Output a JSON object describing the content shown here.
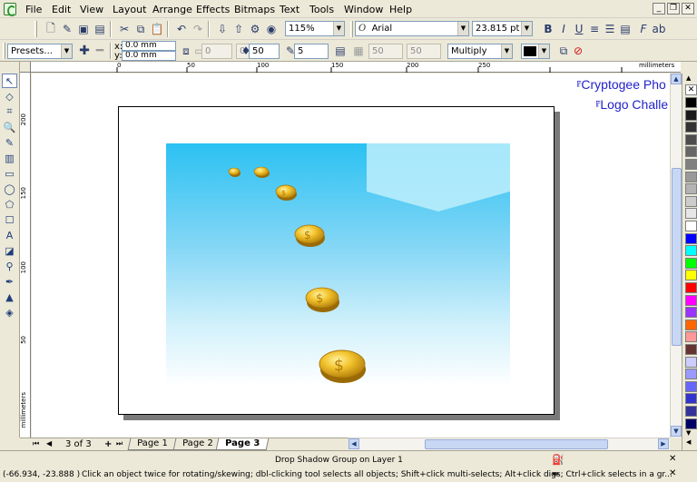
{
  "menu": [
    "File",
    "Edit",
    "View",
    "Layout",
    "Arrange",
    "Effects",
    "Bitmaps",
    "Text",
    "Tools",
    "Window",
    "Help"
  ],
  "toolbar": {
    "zoom": "115%",
    "font_name": "Arial",
    "font_size": "23.815 pt",
    "presets": "Presets...",
    "x_value": "0.0 mm",
    "y_value": "0.0 mm",
    "x_label": "x:",
    "y_label": "y:",
    "offset_a": "0",
    "offset_b": "0",
    "opacity": "50",
    "feather": "5",
    "fade_a": "50",
    "fade_b": "50",
    "blend_mode": "Multiply"
  },
  "ruler": {
    "h_ticks": [
      "0",
      "50",
      "100",
      "150",
      "200",
      "250"
    ],
    "h_units": "millimeters",
    "v_ticks": [
      "200",
      "150",
      "100",
      "50"
    ],
    "v_units": "millimeters"
  },
  "overlay_text": {
    "line1": "Cryptogee Pho",
    "line2": "Logo Challe"
  },
  "page_nav": {
    "counter": "3 of 3",
    "tabs": [
      "Page 1",
      "Page 2",
      "Page 3"
    ],
    "active_tab": "Page 3"
  },
  "status": {
    "object_info": "Drop Shadow Group on Layer 1",
    "coords": "(-66.934, -23.888 )",
    "hint": "Click an object twice for rotating/skewing; dbl-clicking tool selects all objects; Shift+click multi-selects; Alt+click digs; Ctrl+click selects in a gr..."
  },
  "palette_colors": [
    "#000000",
    "#1a1a1a",
    "#333333",
    "#4d4d4d",
    "#666666",
    "#808080",
    "#999999",
    "#b3b3b3",
    "#cccccc",
    "#e6e6e6",
    "#ffffff",
    "#0000ff",
    "#00ffff",
    "#00ff00",
    "#ffff00",
    "#ff0000",
    "#ff00ff",
    "#9933ff",
    "#ff6600",
    "#ff9999",
    "#663333",
    "#ccccff",
    "#9999ff",
    "#6666ff",
    "#3333cc",
    "#333399",
    "#000066"
  ],
  "icons": {
    "app": "corel-logo-icon",
    "close": "close-icon"
  }
}
